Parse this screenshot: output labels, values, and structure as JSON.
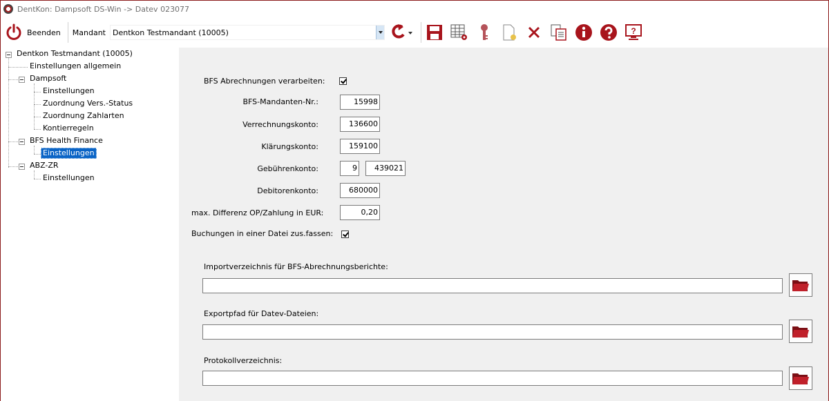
{
  "window": {
    "title": "DentKon: Dampsoft DS-Win -> Datev 023077"
  },
  "toolbar": {
    "quit_label": "Beenden",
    "mandant_label": "Mandant",
    "mandant_value": "Dentkon Testmandant (10005)",
    "icons": [
      "power-icon",
      "refresh-icon",
      "save-icon",
      "table-settings-icon",
      "key-icon",
      "new-document-icon",
      "delete-icon",
      "copy-icon",
      "info-icon",
      "help-icon",
      "screen-help-icon"
    ]
  },
  "tree": {
    "root": "Dentkon Testmandant (10005)",
    "items": [
      {
        "label": "Einstellungen allgemein"
      },
      {
        "label": "Dampsoft"
      },
      {
        "label": "Einstellungen"
      },
      {
        "label": "Zuordnung Vers.-Status"
      },
      {
        "label": "Zuordnung Zahlarten"
      },
      {
        "label": "Kontierregeln"
      },
      {
        "label": "BFS Health Finance"
      },
      {
        "label": "Einstellungen"
      },
      {
        "label": "ABZ-ZR"
      },
      {
        "label": "Einstellungen"
      }
    ],
    "selected": "Einstellungen"
  },
  "form": {
    "bfs_process_label": "BFS Abrechnungen verarbeiten:",
    "bfs_process_checked": true,
    "bfs_mandant_label": "BFS-Mandanten-Nr.:",
    "bfs_mandant_value": "15998",
    "verrechnung_label": "Verrechnungskonto:",
    "verrechnung_value": "136600",
    "klaerung_label": "Klärungskonto:",
    "klaerung_value": "159100",
    "gebuehren_label": "Gebührenkonto:",
    "gebuehren_prefix": "9",
    "gebuehren_value": "439021",
    "debitoren_label": "Debitorenkonto:",
    "debitoren_value": "680000",
    "max_diff_label": "max. Differenz OP/Zahlung in EUR:",
    "max_diff_value": "0,20",
    "buchungen_label": "Buchungen in einer Datei zus.fassen:",
    "buchungen_checked": true,
    "import_label": "Importverzeichnis für BFS-Abrechnungsberichte:",
    "import_value": "",
    "export_label": "Exportpfad für Datev-Dateien:",
    "export_value": "",
    "protokoll_label": "Protokollverzeichnis:",
    "protokoll_value": ""
  },
  "colors": {
    "accent_red": "#a8141c",
    "selection_blue": "#0a64c6",
    "panel_gray": "#f0f0f0"
  }
}
